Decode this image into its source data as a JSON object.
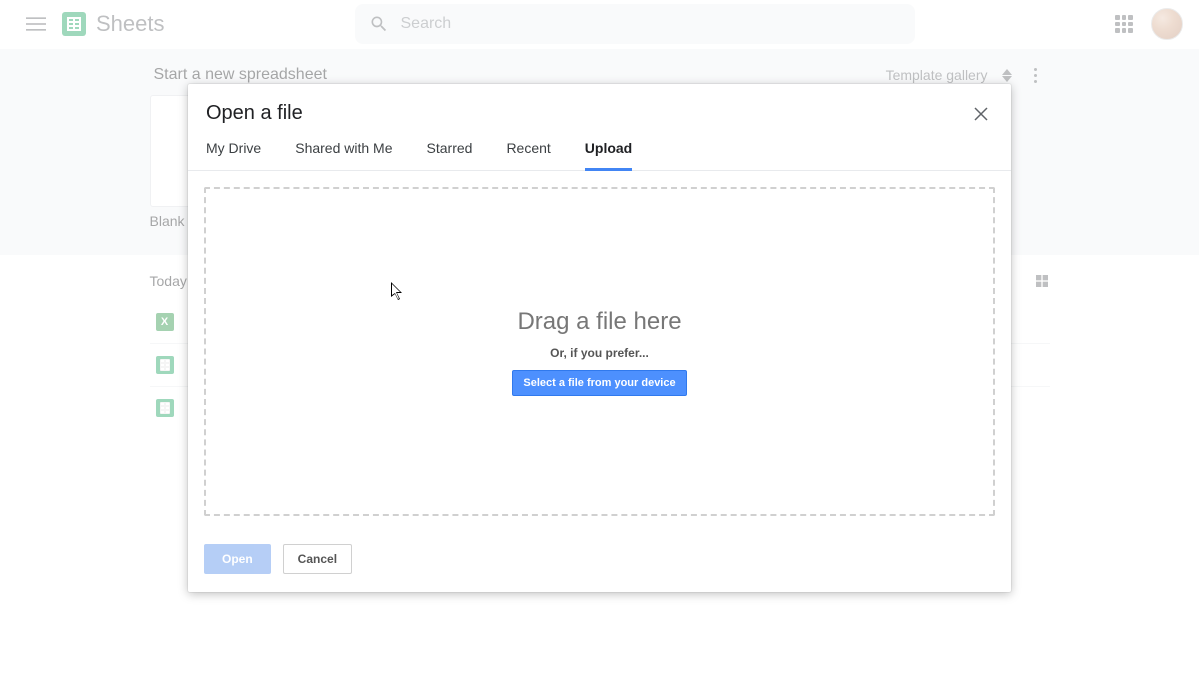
{
  "header": {
    "app_name": "Sheets",
    "search_placeholder": "Search"
  },
  "band": {
    "title": "Start a new spreadsheet",
    "gallery_label": "Template gallery",
    "blank_label": "Blank"
  },
  "files_section": {
    "heading": "Today"
  },
  "modal": {
    "title": "Open a file",
    "tabs": {
      "mydrive": "My Drive",
      "shared": "Shared with Me",
      "starred": "Starred",
      "recent": "Recent",
      "upload": "Upload"
    },
    "active_tab": "upload",
    "dropzone": {
      "title": "Drag a file here",
      "sub": "Or, if you prefer...",
      "button": "Select a file from your device"
    },
    "footer": {
      "open": "Open",
      "cancel": "Cancel"
    }
  }
}
